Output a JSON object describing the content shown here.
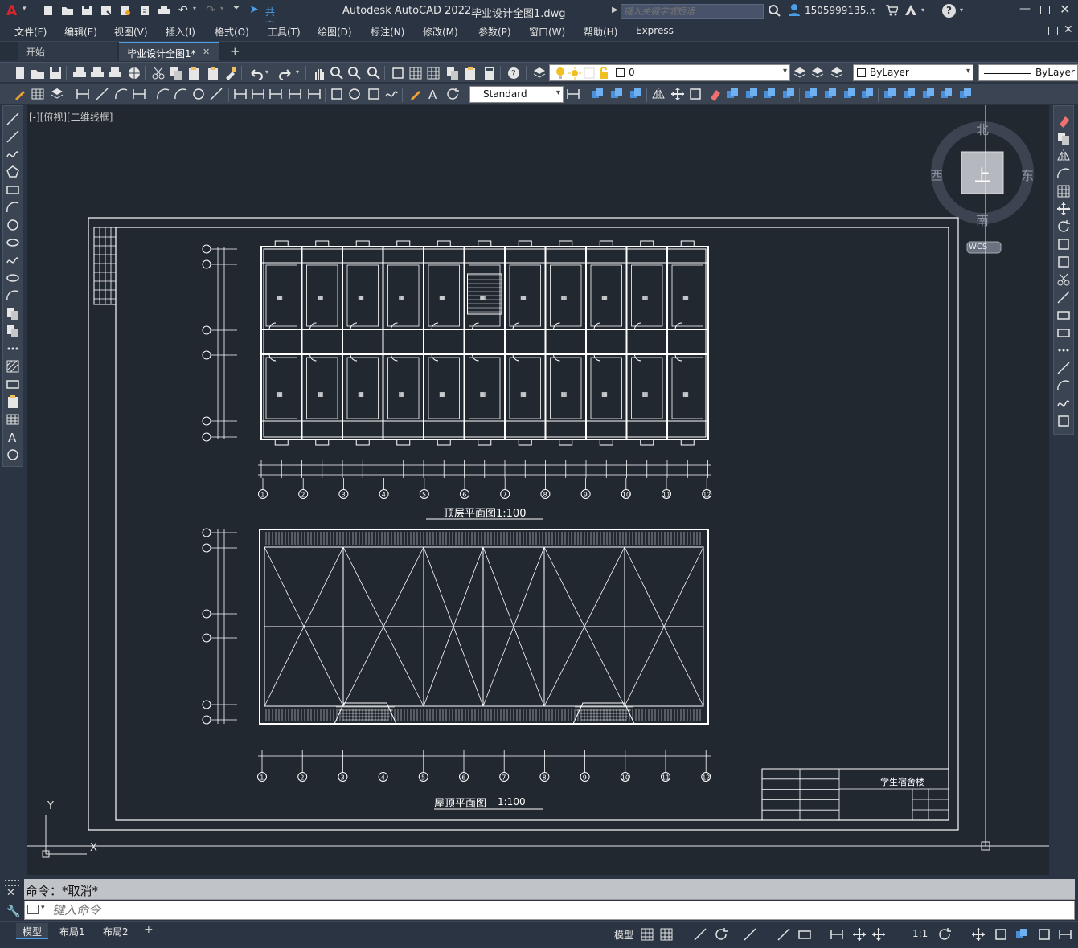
{
  "app": {
    "title": "Autodesk AutoCAD 2022",
    "document": "毕业设计全图1.dwg",
    "share_label": "共享",
    "search_placeholder": "键入关键字或短语",
    "user": "1505999135...",
    "app_letter": "A"
  },
  "menu": [
    "文件(F)",
    "编辑(E)",
    "视图(V)",
    "插入(I)",
    "格式(O)",
    "工具(T)",
    "绘图(D)",
    "标注(N)",
    "修改(M)",
    "参数(P)",
    "窗口(W)",
    "帮助(H)",
    "Express"
  ],
  "tabs": {
    "start": "开始",
    "active": "毕业设计全图1*"
  },
  "toolbar": {
    "layer_value": "0",
    "color_value": "ByLayer",
    "linetype_value": "ByLayer",
    "text_style": "Standard"
  },
  "viewport": {
    "label": "[-][俯视][二维线框]",
    "viewcube_top": "上",
    "north": "北",
    "south": "南",
    "east": "东",
    "west": "西",
    "wcs": "WCS",
    "ucs_y": "Y",
    "ucs_x": "X"
  },
  "drawing": {
    "plan_title": "顶层平面图1:100",
    "roof_title_a": "屋顶平面图",
    "roof_title_b": "1:100",
    "title_block_project": "学生宿舍楼",
    "axis_numbers": [
      "1",
      "2",
      "3",
      "4",
      "5",
      "6",
      "7",
      "8",
      "9",
      "10",
      "11",
      "12"
    ],
    "axis_letters": [
      "F",
      "E",
      "D",
      "C",
      "B",
      "A"
    ]
  },
  "command": {
    "history": "命令：*取消*",
    "placeholder": "键入命令"
  },
  "layouts": [
    "模型",
    "布局1",
    "布局2"
  ],
  "status": {
    "model": "模型",
    "scale": "1:1"
  },
  "colors": {
    "chrome": "#2b3442",
    "toolbar": "#3b4453",
    "canvas": "#212830",
    "line": "#ffffff"
  }
}
